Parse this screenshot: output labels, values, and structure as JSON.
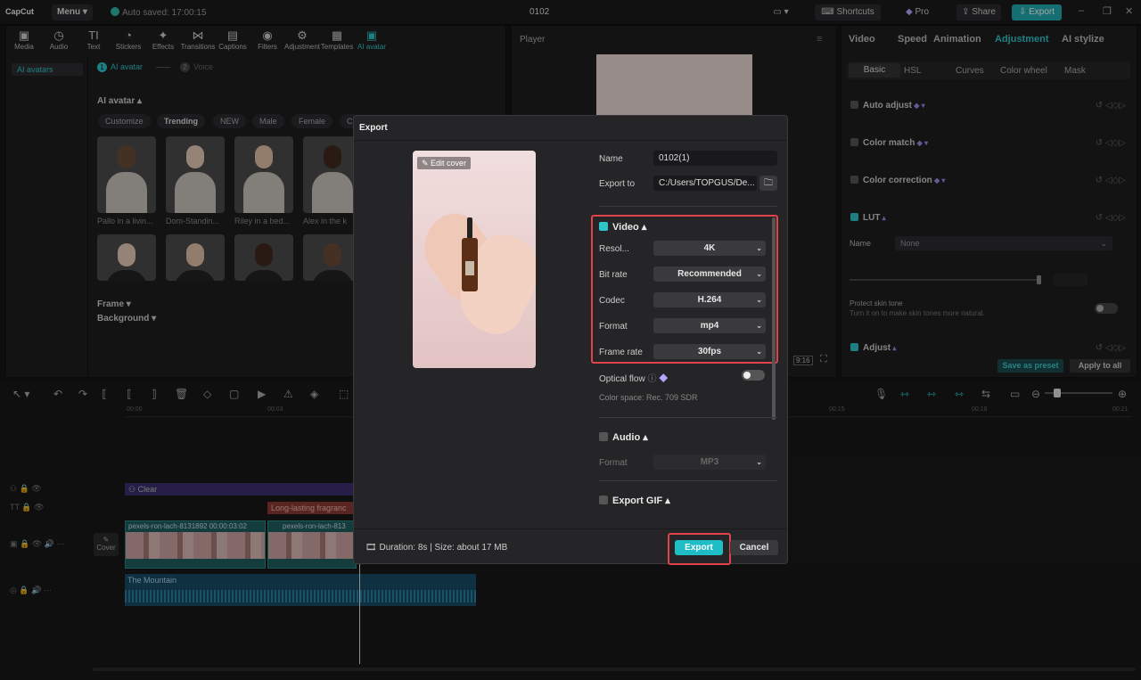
{
  "app": {
    "logo": "CapCut",
    "menu": "Menu",
    "autosave": "Auto saved: 17:00:15",
    "project_title": "0102",
    "pro": "Pro",
    "shortcuts": "Shortcuts",
    "share": "Share",
    "export": "Export"
  },
  "toolbar": [
    {
      "label": "Media",
      "icon": "media-icon",
      "glyph": "▣"
    },
    {
      "label": "Audio",
      "icon": "audio-icon",
      "glyph": "◷"
    },
    {
      "label": "Text",
      "icon": "text-icon",
      "glyph": "TI"
    },
    {
      "label": "Stickers",
      "icon": "stickers-icon",
      "glyph": "◔"
    },
    {
      "label": "Effects",
      "icon": "effects-icon",
      "glyph": "✦"
    },
    {
      "label": "Transitions",
      "icon": "transitions-icon",
      "glyph": "⋈"
    },
    {
      "label": "Captions",
      "icon": "captions-icon",
      "glyph": "▤"
    },
    {
      "label": "Filters",
      "icon": "filters-icon",
      "glyph": "◉"
    },
    {
      "label": "Adjustment",
      "icon": "adjustment-icon",
      "glyph": "⚙"
    },
    {
      "label": "Templates",
      "icon": "templates-icon",
      "glyph": "▦"
    },
    {
      "label": "AI avatar",
      "icon": "ai-avatar-icon",
      "glyph": "▣"
    }
  ],
  "media": {
    "sidebar_item": "AI avatars",
    "step1": "AI avatar",
    "step2": "Voice",
    "section": "AI avatar",
    "chips": [
      "Customize",
      "Trending",
      "NEW",
      "Male",
      "Female",
      "C"
    ],
    "avatars": [
      "Pallo in a livin...",
      "Dom-Standin...",
      "Riley in a bed...",
      "Alex in the k"
    ],
    "frame": "Frame",
    "background": "Background"
  },
  "player": {
    "title": "Player",
    "ratio": "9:16"
  },
  "props": {
    "tabs": [
      "Video",
      "Speed",
      "Animation",
      "Adjustment",
      "AI stylize"
    ],
    "subtabs": [
      "Basic",
      "HSL",
      "Curves",
      "Color wheel",
      "Mask"
    ],
    "rows": [
      "Auto adjust",
      "Color match",
      "Color correction",
      "LUT",
      "Adjust"
    ],
    "lut_name_label": "Name",
    "lut_name_value": "None",
    "protect_title": "Protect skin tone",
    "protect_desc": "Turn it on to make skin tones more natural.",
    "save_preset": "Save as preset",
    "apply_all": "Apply to all"
  },
  "timeline": {
    "ruler": [
      "00:00",
      "00:03",
      "00:15",
      "00:18",
      "00:21"
    ],
    "tracks": {
      "effect": "Clear",
      "text": "Long-lasting fragranc",
      "video1": "pexels-ron-lach-8131892",
      "video1_time": "00:00:03:02",
      "video2": "pexels-ron-lach-813",
      "audio": "The Mountain"
    },
    "cover": "Cover"
  },
  "dialog": {
    "title": "Export",
    "edit_cover": "Edit cover",
    "name_label": "Name",
    "name_value": "0102(1)",
    "export_to_label": "Export to",
    "export_to_value": "C:/Users/TOPGUS/De...",
    "video_section": "Video",
    "resolution_label": "Resol...",
    "resolution": "4K",
    "bitrate_label": "Bit rate",
    "bitrate": "Recommended",
    "codec_label": "Codec",
    "codec": "H.264",
    "format_label": "Format",
    "format": "mp4",
    "framerate_label": "Frame rate",
    "framerate": "30fps",
    "optical_flow": "Optical flow",
    "color_space": "Color space: Rec. 709 SDR",
    "audio_section": "Audio",
    "audio_format_label": "Format",
    "audio_format": "MP3",
    "gif_section": "Export GIF",
    "duration": "Duration: 8s | Size: about 17 MB",
    "export_btn": "Export",
    "cancel_btn": "Cancel"
  },
  "colors": {
    "accent": "#2fc4c9",
    "highlight": "#e0444a",
    "bg": "#1e1e20"
  }
}
